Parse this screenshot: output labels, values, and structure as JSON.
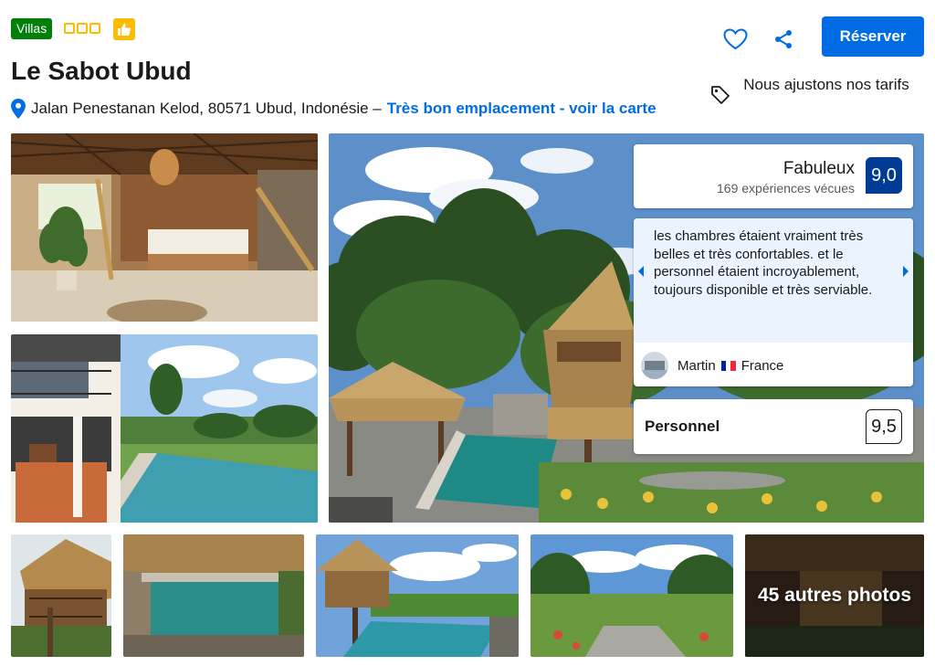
{
  "header": {
    "property_type": "Villas",
    "star_count": 3,
    "title": "Le Sabot Ubud",
    "address": "Jalan Penestanan Kelod, 80571 Ubud, Indonésie –",
    "location_link": "Très bon emplacement - voir la carte"
  },
  "actions": {
    "reserve_label": "Réserver",
    "price_match": "Nous ajustons nos tarifs"
  },
  "rating": {
    "word": "Fabuleux",
    "count_text": "169 expériences vécues",
    "score": "9,0"
  },
  "review": {
    "quote": "les chambres étaient vraiment très belles et très confortables. et le personnel étaient incroyablement, toujours disponible et très serviable.",
    "author": "Martin",
    "country": "France"
  },
  "category_score": {
    "label": "Personnel",
    "score": "9,5"
  },
  "gallery": {
    "more_photos": "45 autres photos"
  },
  "colors": {
    "brand_blue": "#006ce4",
    "score_navy": "#003b95",
    "badge_green": "#008009",
    "star_yellow": "#febb02"
  },
  "icons": [
    "thumbs-up-icon",
    "map-pin-icon",
    "heart-icon",
    "share-icon",
    "price-tag-icon",
    "chevron-left-icon",
    "chevron-right-icon"
  ]
}
